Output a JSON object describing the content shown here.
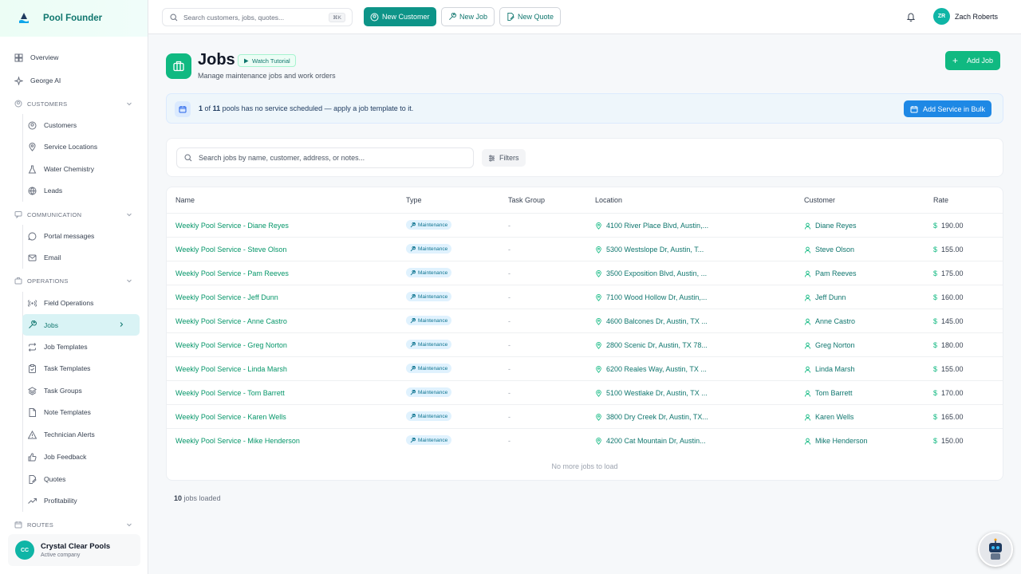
{
  "brand": {
    "name": "Pool Founder"
  },
  "sidebar": {
    "top": [
      {
        "label": "Overview"
      },
      {
        "label": "George AI"
      }
    ],
    "customers_title": "CUSTOMERS",
    "customers": [
      {
        "label": "Customers"
      },
      {
        "label": "Service Locations"
      },
      {
        "label": "Water Chemistry"
      },
      {
        "label": "Leads"
      }
    ],
    "communication_title": "COMMUNICATION",
    "communication": [
      {
        "label": "Portal messages"
      },
      {
        "label": "Email"
      }
    ],
    "operations_title": "OPERATIONS",
    "operations": [
      {
        "label": "Field Operations"
      },
      {
        "label": "Jobs"
      },
      {
        "label": "Job Templates"
      },
      {
        "label": "Task Templates"
      },
      {
        "label": "Task Groups"
      },
      {
        "label": "Note Templates"
      },
      {
        "label": "Technician Alerts"
      },
      {
        "label": "Job Feedback"
      },
      {
        "label": "Quotes"
      },
      {
        "label": "Profitability"
      }
    ],
    "routes_title": "ROUTES",
    "company": {
      "initials": "CC",
      "name": "Crystal Clear Pools",
      "sub": "Active company"
    }
  },
  "topbar": {
    "search_placeholder": "Search customers, jobs, quotes...",
    "shortcut": "⌘K",
    "new_customer": "New Customer",
    "new_job": "New Job",
    "new_quote": "New Quote",
    "user_initials": "ZR",
    "user_name": "Zach Roberts"
  },
  "page": {
    "title": "Jobs",
    "tutorial": "Watch Tutorial",
    "subtitle": "Manage maintenance jobs and work orders",
    "add_job": "Add Job"
  },
  "banner": {
    "count": "1",
    "of": "of",
    "total": "11",
    "text": "pools has no service scheduled — apply a job template to it.",
    "button": "Add Service in Bulk"
  },
  "filters": {
    "search_placeholder": "Search jobs by name, customer, address, or notes...",
    "button": "Filters"
  },
  "table": {
    "columns": [
      "Name",
      "Type",
      "Task Group",
      "Location",
      "Customer",
      "Rate"
    ],
    "rows": [
      {
        "name": "Weekly Pool Service - Diane Reyes",
        "type": "Maintenance",
        "group": "-",
        "location": "4100 River Place Blvd, Austin,...",
        "customer": "Diane Reyes",
        "rate": "190.00"
      },
      {
        "name": "Weekly Pool Service - Steve Olson",
        "type": "Maintenance",
        "group": "-",
        "location": "5300 Westslope Dr, Austin, T...",
        "customer": "Steve Olson",
        "rate": "155.00"
      },
      {
        "name": "Weekly Pool Service - Pam Reeves",
        "type": "Maintenance",
        "group": "-",
        "location": "3500 Exposition Blvd, Austin, ...",
        "customer": "Pam Reeves",
        "rate": "175.00"
      },
      {
        "name": "Weekly Pool Service - Jeff Dunn",
        "type": "Maintenance",
        "group": "-",
        "location": "7100 Wood Hollow Dr, Austin,...",
        "customer": "Jeff Dunn",
        "rate": "160.00"
      },
      {
        "name": "Weekly Pool Service - Anne Castro",
        "type": "Maintenance",
        "group": "-",
        "location": "4600 Balcones Dr, Austin, TX ...",
        "customer": "Anne Castro",
        "rate": "145.00"
      },
      {
        "name": "Weekly Pool Service - Greg Norton",
        "type": "Maintenance",
        "group": "-",
        "location": "2800 Scenic Dr, Austin, TX 78...",
        "customer": "Greg Norton",
        "rate": "180.00"
      },
      {
        "name": "Weekly Pool Service - Linda Marsh",
        "type": "Maintenance",
        "group": "-",
        "location": "6200 Reales Way, Austin, TX ...",
        "customer": "Linda Marsh",
        "rate": "155.00"
      },
      {
        "name": "Weekly Pool Service - Tom Barrett",
        "type": "Maintenance",
        "group": "-",
        "location": "5100 Westlake Dr, Austin, TX ...",
        "customer": "Tom Barrett",
        "rate": "170.00"
      },
      {
        "name": "Weekly Pool Service - Karen Wells",
        "type": "Maintenance",
        "group": "-",
        "location": "3800 Dry Creek Dr, Austin, TX...",
        "customer": "Karen Wells",
        "rate": "165.00"
      },
      {
        "name": "Weekly Pool Service - Mike Henderson",
        "type": "Maintenance",
        "group": "-",
        "location": "4200 Cat Mountain Dr, Austin...",
        "customer": "Mike Henderson",
        "rate": "150.00"
      }
    ],
    "no_more": "No more jobs to load",
    "loaded_count": "10",
    "loaded_label": "jobs loaded"
  }
}
